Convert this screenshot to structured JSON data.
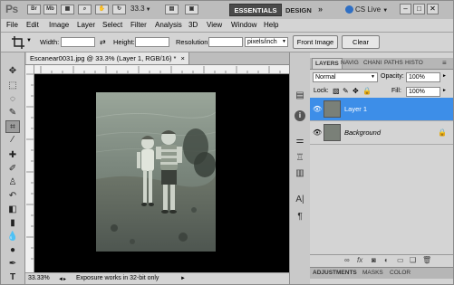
{
  "app": {
    "logo": "Ps",
    "icons": [
      "Br",
      "Mb"
    ],
    "zoom": "33.3",
    "workspace_active": "ESSENTIALS",
    "workspace_other": "DESIGN",
    "more": "»",
    "cs_live": "CS Live",
    "window_buttons": [
      "–",
      "□",
      "✕"
    ]
  },
  "menu": [
    "File",
    "Edit",
    "Image",
    "Layer",
    "Select",
    "Filter",
    "Analysis",
    "3D",
    "View",
    "Window",
    "Help"
  ],
  "options": {
    "width_label": "Width:",
    "height_label": "Height:",
    "resolution_label": "Resolution:",
    "unit": "pixels/inch",
    "front_image": "Front Image",
    "clear": "Clear"
  },
  "document": {
    "tab_title": "Escanear0031.jpg @ 33.3% (Layer 1, RGB/16) *",
    "zoom": "33.33%",
    "status": "Exposure works in 32-bit only"
  },
  "layers_panel": {
    "tabs": [
      "LAYERS",
      "NAVIG",
      "CHANI",
      "PATHS",
      "HISTO"
    ],
    "blend_mode": "Normal",
    "opacity_label": "Opacity:",
    "opacity": "100%",
    "lock_label": "Lock:",
    "fill_label": "Fill:",
    "fill": "100%",
    "layers": [
      {
        "name": "Layer 1",
        "active": true
      },
      {
        "name": "Background",
        "active": false
      }
    ],
    "bottom_tabs": [
      "ADJUSTMENTS",
      "MASKS",
      "COLOR"
    ]
  },
  "colors": {
    "accent": "#3d8ee8",
    "chrome": "#d4d4d4",
    "canvas": "#000000"
  }
}
